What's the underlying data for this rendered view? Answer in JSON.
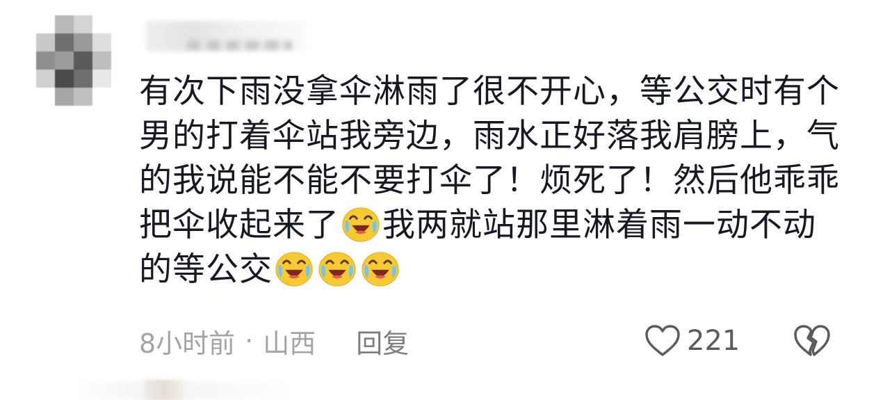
{
  "comment": {
    "text_parts": {
      "part1": "有次下雨没拿伞淋雨了很不开心，等公交时有个男的打着伞站我旁边，雨水正好落我肩膀上，气的我说能不能不要打伞了！烦死了！然后他乖乖把伞收起来了",
      "part2": "我两就站那里淋着雨一动不动的等公交"
    },
    "emoji_names": [
      "crying-laughing-emoji",
      "crying-laughing-emoji",
      "crying-laughing-emoji",
      "crying-laughing-emoji"
    ],
    "time": "8小时前",
    "separator": "·",
    "location": "山西",
    "reply_label": "回复",
    "like_count": "221"
  },
  "colors": {
    "text": "#161823",
    "meta": "#a3a4a8",
    "reply": "#7c7d82",
    "like_icon": "#5a5b60",
    "emoji_face": "#f7c934"
  }
}
